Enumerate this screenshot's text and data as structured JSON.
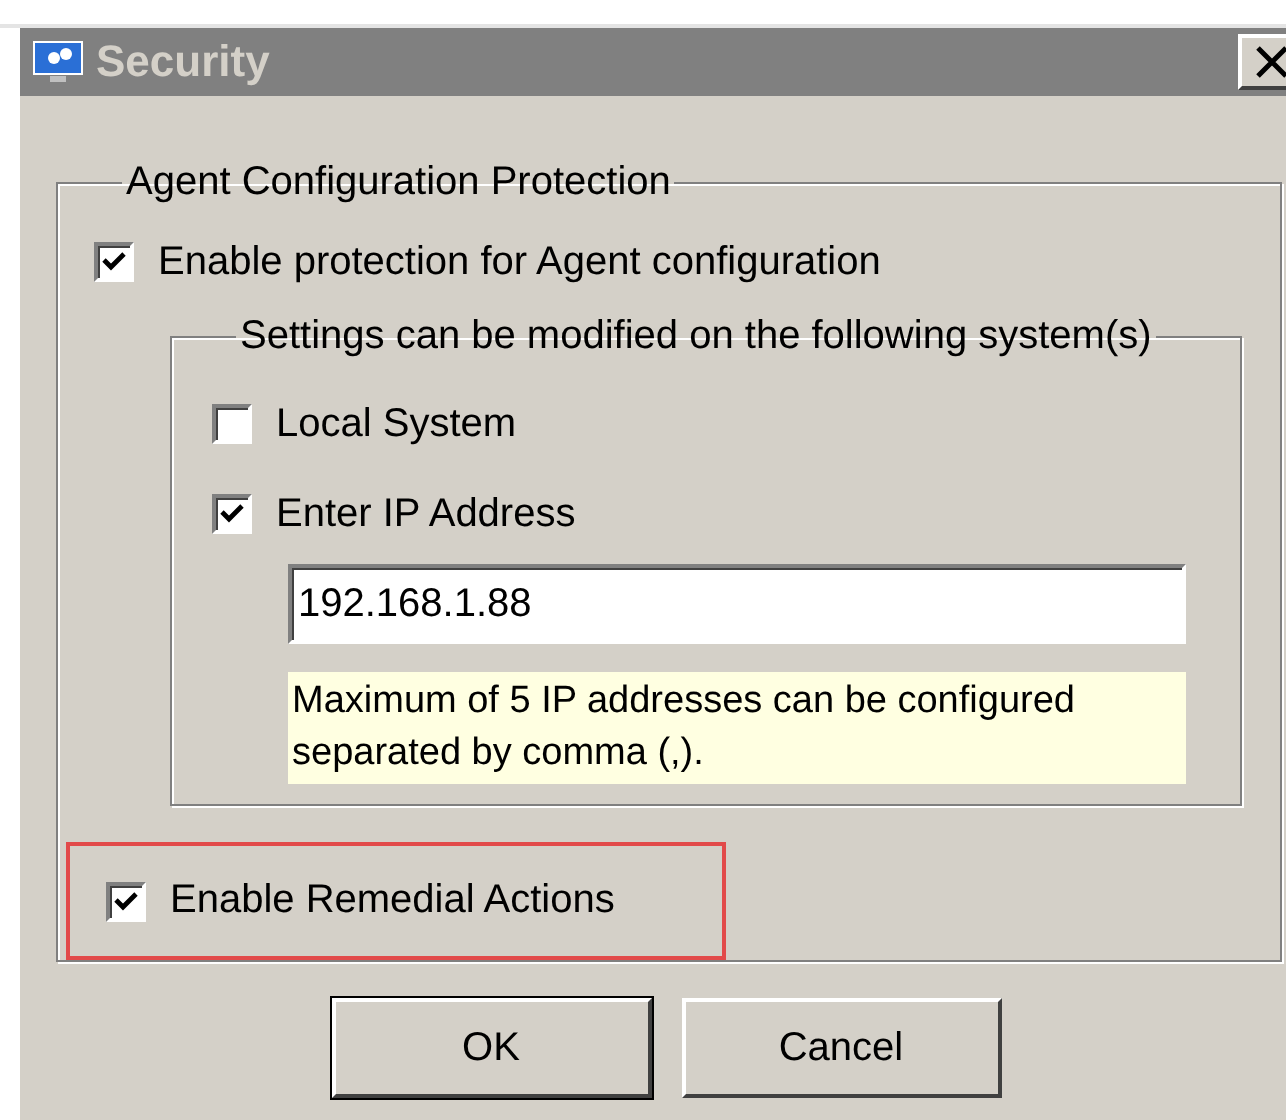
{
  "window": {
    "title": "Security",
    "active": false
  },
  "protection_group": {
    "title": "Agent Configuration Protection",
    "enable_protection": {
      "label": "Enable protection for Agent configuration",
      "checked": true
    },
    "systems_group": {
      "title": "Settings can be modified on the following system(s)",
      "options": [
        {
          "label": "Local System",
          "checked": false
        },
        {
          "label": "Enter IP Address",
          "checked": true
        }
      ],
      "ip_field": {
        "value": "192.168.1.88"
      },
      "note": "Maximum of 5 IP addresses can be configured separated by comma (,)."
    },
    "remedial_actions": {
      "label": "Enable Remedial Actions",
      "checked": true,
      "highlighted": true
    }
  },
  "buttons": [
    {
      "label": "OK",
      "default": true
    },
    {
      "label": "Cancel",
      "default": false
    }
  ]
}
